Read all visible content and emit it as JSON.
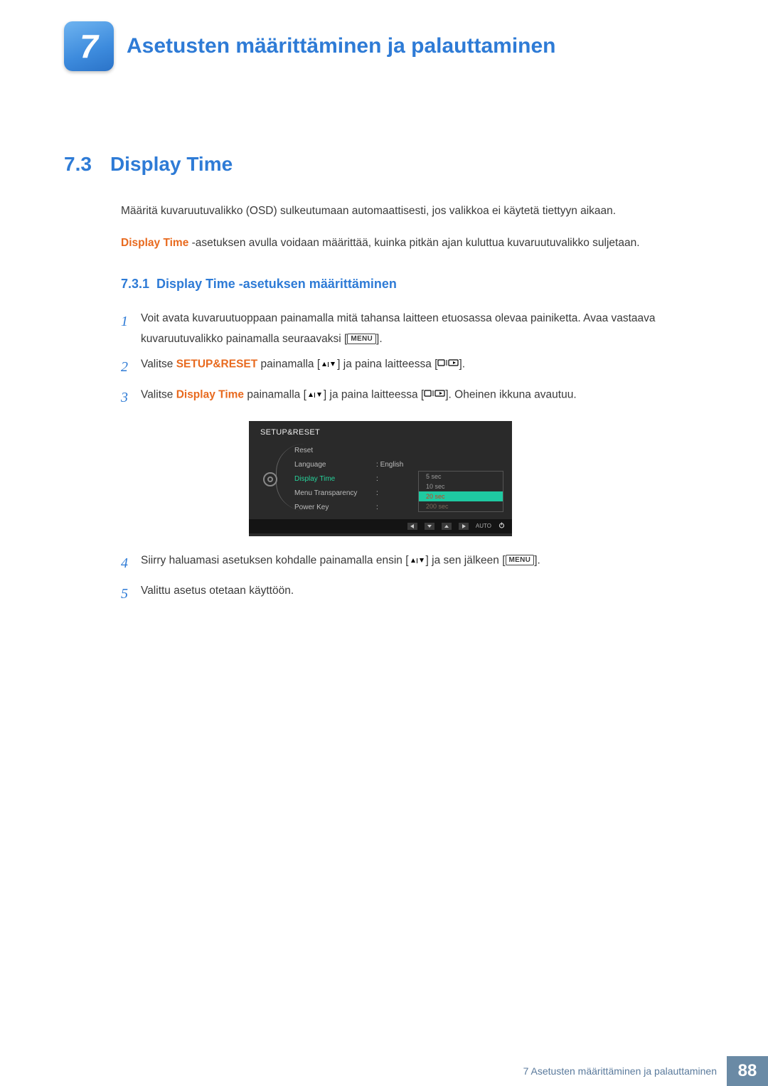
{
  "chapter": {
    "num": "7",
    "title": "Asetusten määrittäminen ja palauttaminen"
  },
  "section": {
    "num": "7.3",
    "title": "Display Time"
  },
  "para1": "Määritä kuvaruutuvalikko (OSD) sulkeutumaan automaattisesti, jos valikkoa ei käytetä tiettyyn aikaan.",
  "para2_accent": "Display Time",
  "para2_rest": " -asetuksen avulla voidaan määrittää, kuinka pitkän ajan kuluttua kuvaruutuvalikko suljetaan.",
  "subsection": {
    "num": "7.3.1",
    "title": "Display Time -asetuksen määrittäminen"
  },
  "steps": {
    "1": {
      "n": "1",
      "a": "Voit avata kuvaruutuoppaan painamalla mitä tahansa laitteen etuosassa olevaa painiketta. Avaa vastaava kuvaruutuvalikko painamalla seuraavaksi [",
      "b": "].",
      "menu": "MENU"
    },
    "2": {
      "n": "2",
      "a": "Valitse ",
      "accent": "SETUP&RESET",
      "b": " painamalla [",
      "c": "] ja paina laitteessa [",
      "d": "]."
    },
    "3": {
      "n": "3",
      "a": "Valitse ",
      "accent": "Display Time",
      "b": " painamalla [",
      "c": "] ja paina laitteessa [",
      "d": "]. Oheinen ikkuna avautuu."
    },
    "4": {
      "n": "4",
      "a": "Siirry haluamasi asetuksen kohdalle painamalla ensin [",
      "b": "] ja sen jälkeen [",
      "c": "].",
      "menu": "MENU"
    },
    "5": {
      "n": "5",
      "a": "Valittu asetus otetaan käyttöön."
    }
  },
  "osd": {
    "title": "SETUP&RESET",
    "rows": {
      "reset": "Reset",
      "language": "Language",
      "language_val": "English",
      "display_time": "Display Time",
      "menu_transparency": "Menu Transparency",
      "power_key": "Power Key"
    },
    "colon": ":",
    "options": [
      "5 sec",
      "10 sec",
      "20 sec",
      "200 sec"
    ],
    "auto": "AUTO"
  },
  "footer": {
    "text": "7 Asetusten määrittäminen ja palauttaminen",
    "page": "88"
  }
}
